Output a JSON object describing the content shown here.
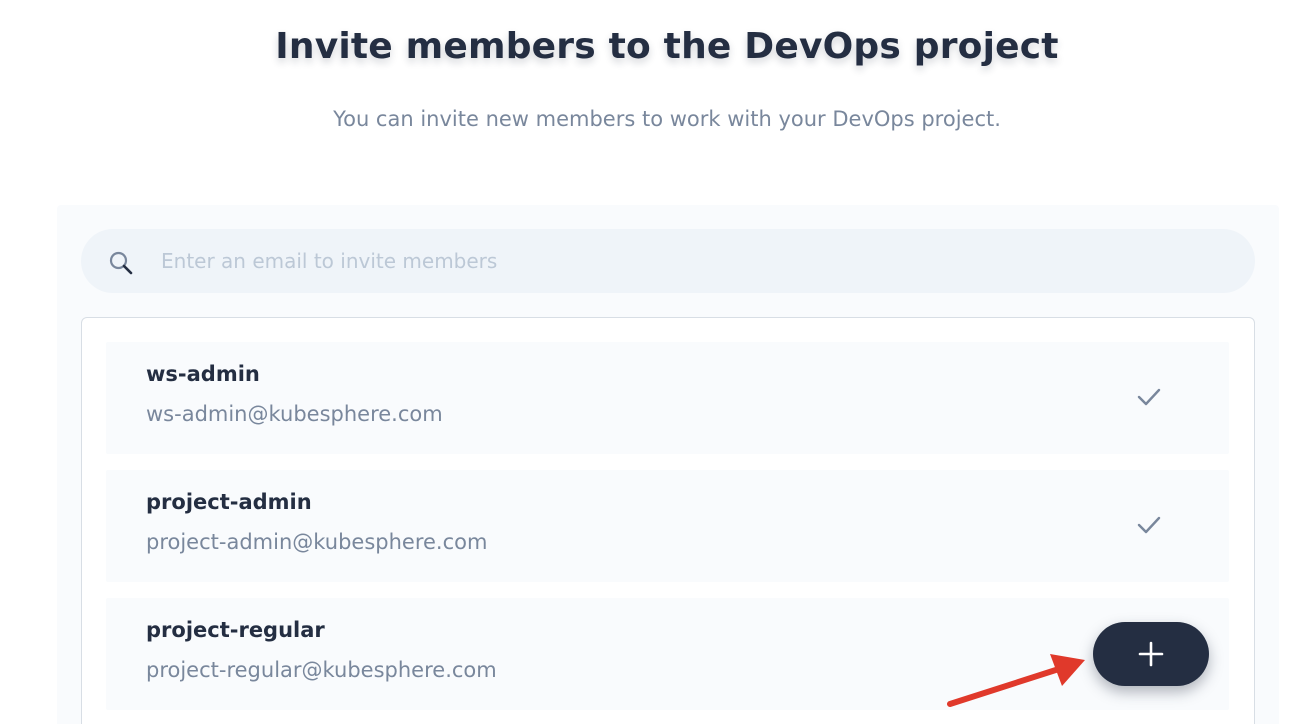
{
  "header": {
    "title": "Invite members to the DevOps project",
    "subtitle": "You can invite new members to work with your DevOps project."
  },
  "search": {
    "placeholder": "Enter an email to invite members",
    "value": "",
    "icon": "search-icon"
  },
  "members": [
    {
      "name": "ws-admin",
      "email": "ws-admin@kubesphere.com",
      "status": "invited",
      "icon": "check-icon"
    },
    {
      "name": "project-admin",
      "email": "project-admin@kubesphere.com",
      "status": "invited",
      "icon": "check-icon"
    },
    {
      "name": "project-regular",
      "email": "project-regular@kubesphere.com",
      "status": "not-invited",
      "icon": "plus-icon"
    }
  ],
  "colors": {
    "primary_dark": "#242e42",
    "text_secondary": "#79879c",
    "panel_bg": "#f9fbfd",
    "search_bg": "#eff4f9",
    "annotation_arrow": "#e0392b"
  }
}
